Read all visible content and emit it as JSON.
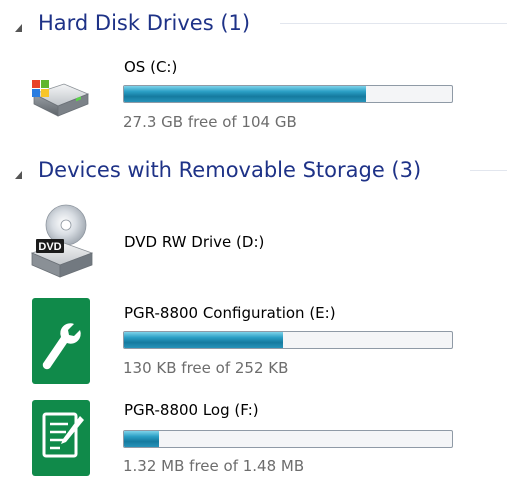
{
  "groups": [
    {
      "title": "Hard Disk Drives (1)"
    },
    {
      "title": "Devices with Removable Storage (3)"
    }
  ],
  "drives": [
    {
      "name": "OS (C:)",
      "free_text": "27.3 GB free of 104 GB",
      "used_fraction": 0.738,
      "icon": "hard-disk-windows-icon"
    },
    {
      "name": "DVD RW Drive (D:)",
      "icon": "dvd-drive-icon",
      "icon_label": "DVD"
    },
    {
      "name": "PGR-8800 Configuration (E:)",
      "free_text": "130 KB free of 252 KB",
      "used_fraction": 0.484,
      "icon": "wrench-icon"
    },
    {
      "name": "PGR-8800 Log (F:)",
      "free_text": "1.32 MB free of 1.48 MB",
      "used_fraction": 0.108,
      "icon": "notepad-pencil-icon"
    }
  ],
  "colors": {
    "group_title": "#1e3287",
    "bar_fill": "#157a9f",
    "device_icon_bg": "#108a4a"
  }
}
